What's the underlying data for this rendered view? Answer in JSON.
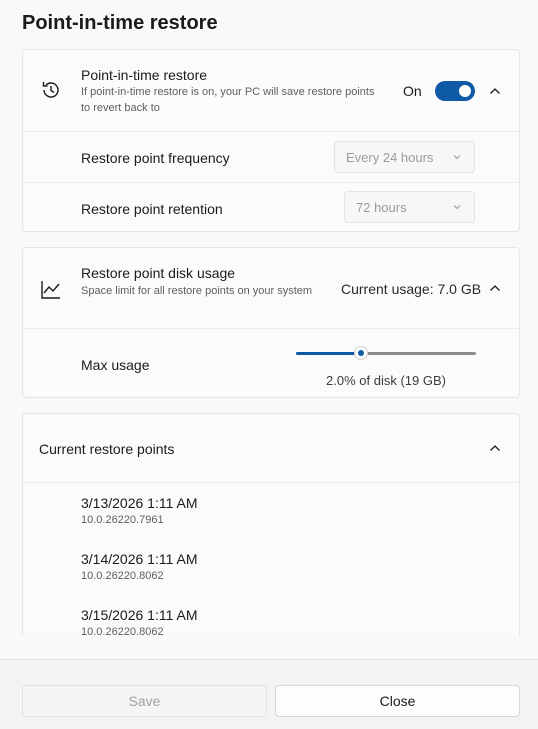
{
  "page": {
    "title": "Point-in-time restore"
  },
  "pitr": {
    "title": "Point-in-time restore",
    "description": "If point-in-time restore is on, your PC will save restore points to revert back to",
    "toggle_state": "On",
    "toggle_on": true,
    "frequency": {
      "label": "Restore point frequency",
      "value": "Every 24 hours"
    },
    "retention": {
      "label": "Restore point retention",
      "value": "72 hours"
    }
  },
  "disk": {
    "title": "Restore point disk usage",
    "description": "Space limit for all restore points on your system",
    "current_usage": "Current usage: 7.0 GB",
    "max_usage_label": "Max usage",
    "slider_value_percent": 36,
    "slider_caption": "2.0% of disk (19 GB)"
  },
  "restore_points": {
    "title": "Current restore points",
    "items": [
      {
        "date": "3/13/2026 1:11 AM",
        "version": "10.0.26220.7961"
      },
      {
        "date": "3/14/2026 1:11 AM",
        "version": "10.0.26220.8062"
      },
      {
        "date": "3/15/2026 1:11 AM",
        "version": "10.0.26220.8062"
      }
    ]
  },
  "footer": {
    "save_label": "Save",
    "close_label": "Close"
  },
  "colors": {
    "accent": "#0f5aa7",
    "background": "#f9f9f9",
    "card": "#fbfbfb"
  }
}
